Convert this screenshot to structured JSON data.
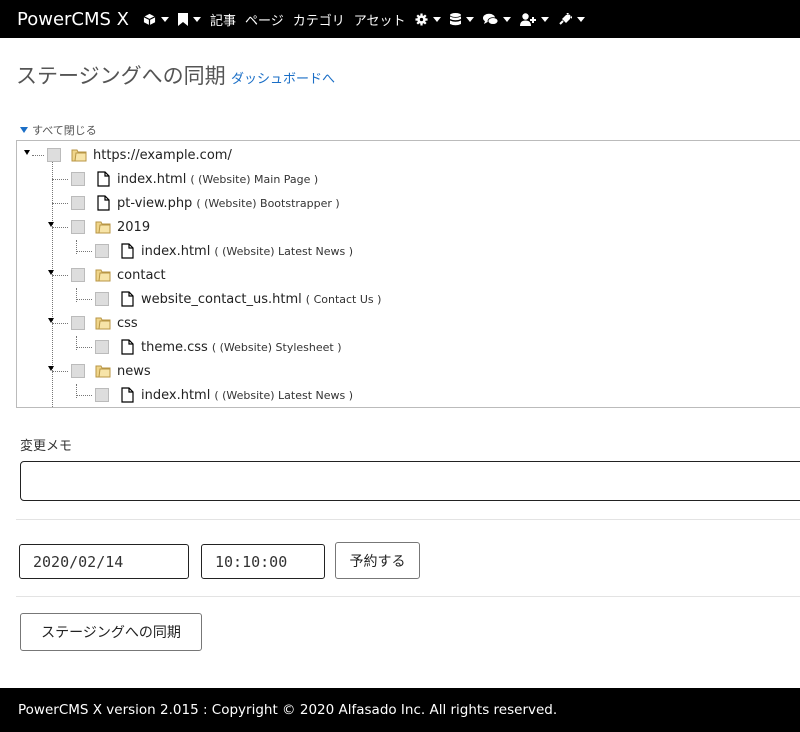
{
  "navbar": {
    "brand": "PowerCMS X",
    "items": [
      {
        "icon": "cube-icon",
        "has_caret": true
      },
      {
        "icon": "bookmark-icon",
        "has_caret": true
      },
      {
        "label": "記事"
      },
      {
        "label": "ページ"
      },
      {
        "label": "カテゴリ"
      },
      {
        "label": "アセット"
      },
      {
        "icon": "gear-icon",
        "has_caret": true
      },
      {
        "icon": "database-icon",
        "has_caret": true
      },
      {
        "icon": "comments-icon",
        "has_caret": true
      },
      {
        "icon": "user-plus-icon",
        "has_caret": true
      },
      {
        "icon": "plug-icon",
        "has_caret": true
      }
    ]
  },
  "page": {
    "title": "ステージングへの同期",
    "dashboard_link": "ダッシュボードへ",
    "collapse_all": "すべて閉じる"
  },
  "tree": {
    "items": [
      {
        "type": "folder",
        "name": "https://example.com/",
        "desc": ""
      },
      {
        "type": "file",
        "name": "index.html",
        "desc": "( (Website) Main Page )"
      },
      {
        "type": "file",
        "name": "pt-view.php",
        "desc": "( (Website) Bootstrapper )"
      },
      {
        "type": "folder",
        "name": "2019",
        "desc": ""
      },
      {
        "type": "file",
        "name": "index.html",
        "desc": "( (Website) Latest News )"
      },
      {
        "type": "folder",
        "name": "contact",
        "desc": ""
      },
      {
        "type": "file",
        "name": "website_contact_us.html",
        "desc": "( Contact Us )"
      },
      {
        "type": "folder",
        "name": "css",
        "desc": ""
      },
      {
        "type": "file",
        "name": "theme.css",
        "desc": "( (Website) Stylesheet )"
      },
      {
        "type": "folder",
        "name": "news",
        "desc": ""
      },
      {
        "type": "file",
        "name": "index.html",
        "desc": "( (Website) Latest News )"
      }
    ]
  },
  "memo": {
    "label": "変更メモ",
    "value": ""
  },
  "schedule": {
    "date": "2020/02/14",
    "time": "10:10:00",
    "button": "予約する"
  },
  "sync_button": "ステージングへの同期",
  "footer": "PowerCMS X version 2.015 : Copyright © 2020 Alfasado Inc. All rights reserved.",
  "colors": {
    "accent": "#1a6ec6",
    "navbar": "#000000"
  }
}
